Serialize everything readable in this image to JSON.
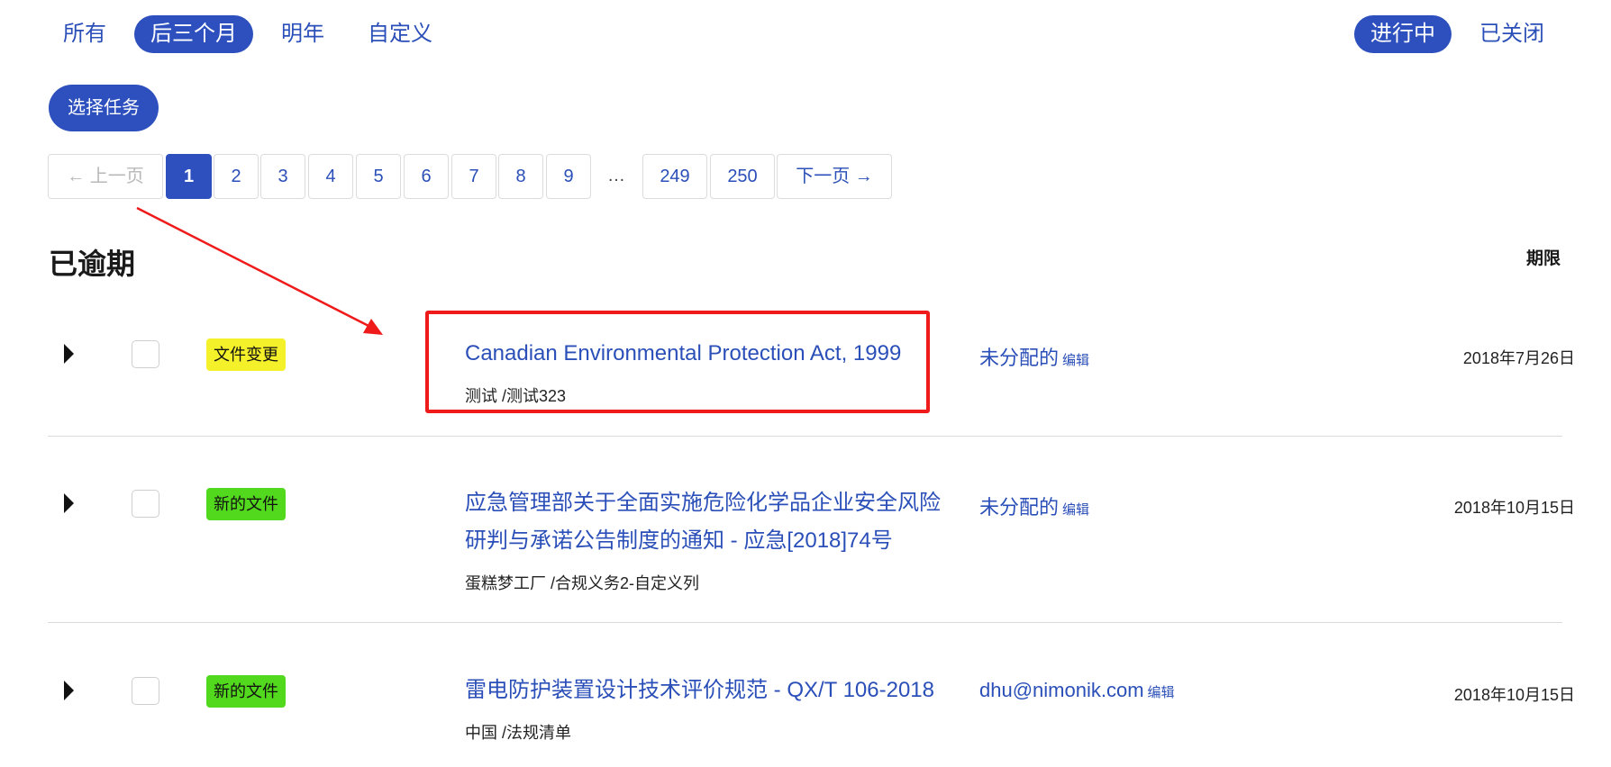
{
  "filters": {
    "time": [
      {
        "label": "所有",
        "active": false
      },
      {
        "label": "后三个月",
        "active": true
      },
      {
        "label": "明年",
        "active": false
      },
      {
        "label": "自定义",
        "active": false
      }
    ],
    "status": [
      {
        "label": "进行中",
        "active": true
      },
      {
        "label": "已关闭",
        "active": false
      }
    ]
  },
  "actions": {
    "select_tasks": "选择任务"
  },
  "pagination": {
    "prev": "← 上一页",
    "pages": [
      "1",
      "2",
      "3",
      "4",
      "5",
      "6",
      "7",
      "8",
      "9"
    ],
    "ellipsis": "…",
    "last_pages": [
      "249",
      "250"
    ],
    "next": "下一页 →",
    "current": "1"
  },
  "section": {
    "title": "已逾期",
    "due_header": "期限"
  },
  "rows": [
    {
      "tag": "文件变更",
      "tag_color": "#f4f02a",
      "title": "Canadian Environmental Protection Act, 1999",
      "subtitle": "测试 /测试323",
      "assignee": "未分配的",
      "edit": "编辑",
      "due": "2018年7月26日"
    },
    {
      "tag": "新的文件",
      "tag_color": "#52d91d",
      "title": "应急管理部关于全面实施危险化学品企业安全风险研判与承诺公告制度的通知 - 应急[2018]74号",
      "subtitle": "蛋糕梦工厂 /合规义务2-自定义列",
      "assignee": "未分配的",
      "edit": "编辑",
      "due": "2018年10月15日"
    },
    {
      "tag": "新的文件",
      "tag_color": "#52d91d",
      "title": "雷电防护装置设计技术评价规范 - QX/T 106-2018",
      "subtitle": "中国 /法规清单",
      "assignee": "dhu@nimonik.com",
      "edit": "编辑",
      "due": "2018年10月15日"
    }
  ],
  "annotation_color": "#ef1b1b"
}
